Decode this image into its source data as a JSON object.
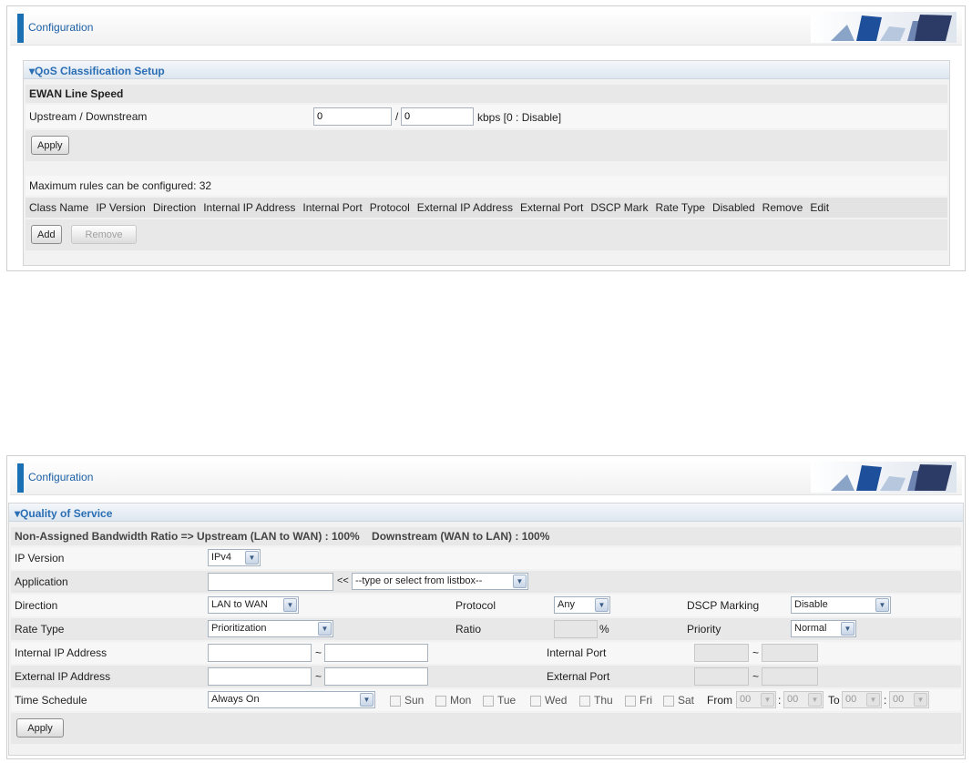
{
  "panel1": {
    "header": {
      "title": "Configuration"
    },
    "section_title": "QoS Classification Setup",
    "ewan_heading": "EWAN Line Speed",
    "speed_label": "Upstream / Downstream",
    "upstream_value": "0",
    "separator": "/",
    "downstream_value": "0",
    "speed_hint": "kbps [0 : Disable]",
    "apply_label": "Apply",
    "max_rules_text": "Maximum rules can be configured: 32",
    "columns": [
      "Class Name",
      "IP Version",
      "Direction",
      "Internal IP Address",
      "Internal Port",
      "Protocol",
      "External IP Address",
      "External Port",
      "DSCP Mark",
      "Rate Type",
      "Disabled",
      "Remove",
      "Edit"
    ],
    "add_label": "Add",
    "remove_label": "Remove"
  },
  "panel2": {
    "header": {
      "title": "Configuration"
    },
    "section_title": "Quality of Service",
    "bandwidth_text": "Non-Assigned Bandwidth Ratio => Upstream (LAN to WAN) : 100%    Downstream (WAN to LAN) : 100%",
    "ip_version_label": "IP Version",
    "ip_version_value": "IPv4",
    "application_label": "Application",
    "application_value": "",
    "application_arrow": "<<",
    "application_select": "--type or select from listbox--",
    "direction_label": "Direction",
    "direction_value": "LAN to WAN",
    "protocol_label": "Protocol",
    "protocol_value": "Any",
    "dscp_label": "DSCP Marking",
    "dscp_value": "Disable",
    "rate_type_label": "Rate Type",
    "rate_type_value": "Prioritization",
    "ratio_label": "Ratio",
    "ratio_value": "",
    "ratio_unit": "%",
    "priority_label": "Priority",
    "priority_value": "Normal",
    "internal_ip_label": "Internal IP Address",
    "internal_port_label": "Internal Port",
    "external_ip_label": "External IP Address",
    "external_port_label": "External Port",
    "range_sep": "~",
    "time_schedule_label": "Time Schedule",
    "time_schedule_value": "Always On",
    "days": [
      "Sun",
      "Mon",
      "Tue",
      "Wed",
      "Thu",
      "Fri",
      "Sat"
    ],
    "from_label": "From",
    "to_label": "To",
    "from_hour": "00",
    "from_min": "00",
    "to_hour": "00",
    "to_min": "00",
    "time_sep": ":",
    "apply_label": "Apply"
  },
  "colors": {
    "accent": "#1b6fb3",
    "section_text": "#2a6eb5"
  },
  "icons": [
    "header-art-icon",
    "section-collapse-icon",
    "dropdown-arrow-icon",
    "checkbox-icon"
  ]
}
